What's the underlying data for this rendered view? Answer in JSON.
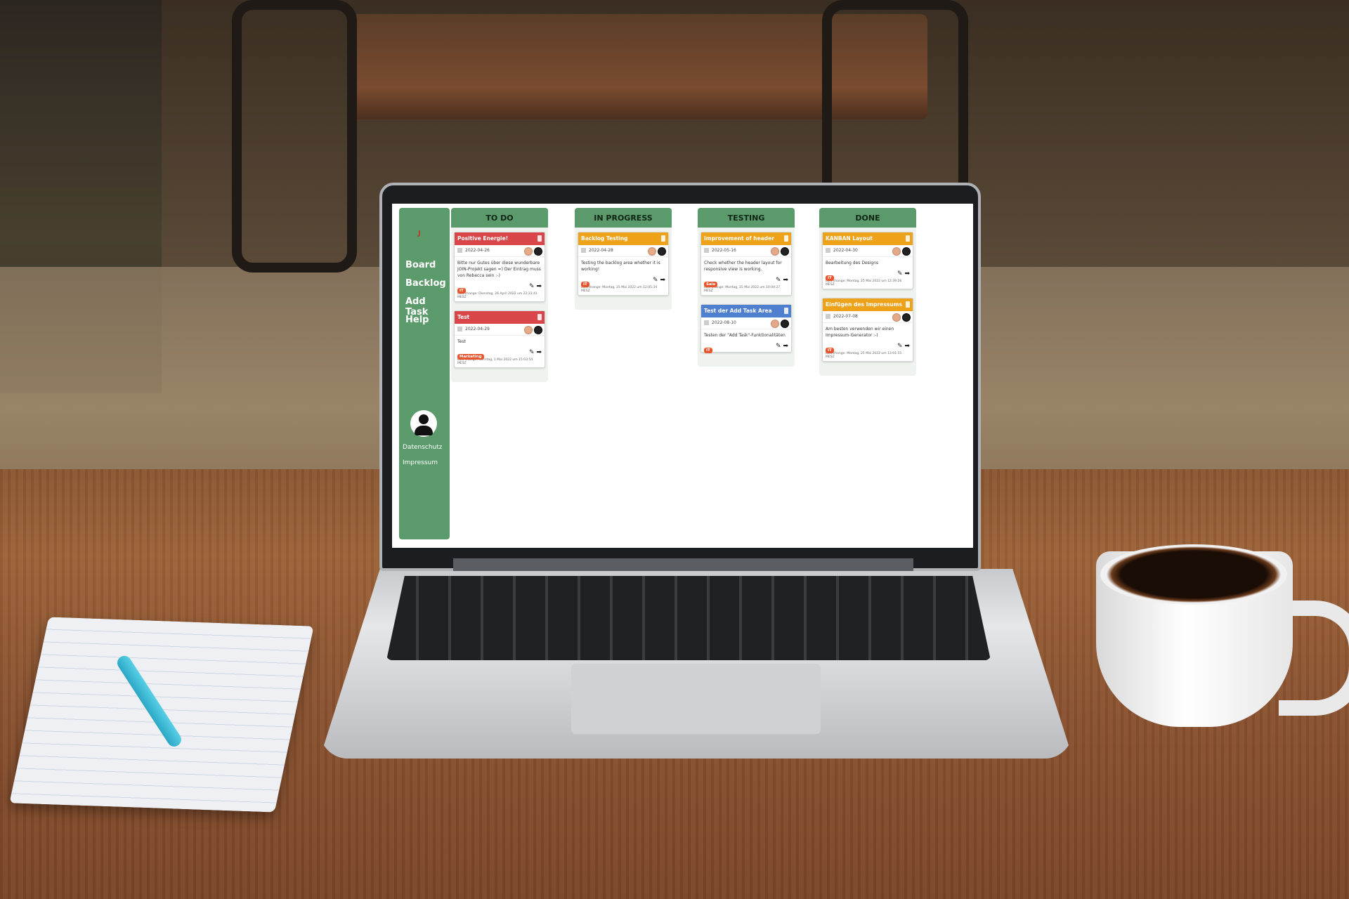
{
  "scene": {
    "colors": {
      "table": "#8b5632",
      "sidebar": "#5b9a6b",
      "todo_red": "#d9464a",
      "progress_orange": "#eda21a",
      "testing_blue": "#4f7fcf",
      "tag_orange": "#e8542c"
    }
  },
  "app": {
    "logo": "J",
    "nav": [
      "Board",
      "Backlog",
      "Add Task",
      "Help"
    ],
    "footer": [
      "Datenschutz",
      "Impressum"
    ]
  },
  "columns": [
    {
      "title": "TO DO",
      "cards": [
        {
          "title": "Positive Energie!",
          "date": "2022-04-26",
          "desc": "Bitte nur Gutes über diese wunderbare JOIN-Projekt sagen =) Der Eintrag muss von Rebecca sein :-)",
          "tag": "IT",
          "change": "Last change: Dienstag, 26 April 2022 um 22:31:41 MESZ",
          "color": "#d9464a"
        },
        {
          "title": "Test",
          "date": "2022-04-29",
          "desc": "Test",
          "tag": "Marketing",
          "change": "Last change: Sonntag, 1 Mai 2022 um 15:03:54 MESZ",
          "color": "#d9464a"
        }
      ]
    },
    {
      "title": "IN PROGRESS",
      "cards": [
        {
          "title": "Backlog Testing",
          "date": "2022-04-28",
          "desc": "Testing the backlog area whether it is working!",
          "tag": "IT",
          "change": "Last change: Montag, 25 Mai 2022 um 12:05:34 MESZ",
          "color": "#eda21a"
        }
      ]
    },
    {
      "title": "TESTING",
      "cards": [
        {
          "title": "Improvement of header layout",
          "date": "2022-05-16",
          "desc": "Check whether the header layout for responsive view is working.",
          "tag": "Sale",
          "change": "Last change: Montag, 25 Mai 2022 um 10:04:27 MESZ",
          "color": "#eda21a"
        },
        {
          "title": "Test der Add Task Area",
          "date": "2022-08-10",
          "desc": "Testen der \"Add Task\"-Funktionalitäten",
          "tag": "IT",
          "change": "",
          "color": "#4f7fcf"
        }
      ]
    },
    {
      "title": "DONE",
      "cards": [
        {
          "title": "KANBAN Layout",
          "date": "2022-04-30",
          "desc": "Bearbeitung des Designs",
          "tag": "IT",
          "change": "Last change: Montag, 25 Mai 2022 um 12:39:26 MESZ",
          "color": "#eda21a"
        },
        {
          "title": "Einfügen des Impressums",
          "date": "2022-07-08",
          "desc": "Am besten verwenden wir einen Impressum-Generator :-)",
          "tag": "IT",
          "change": "Last change: Montag, 25 Mai 2022 um 13:01:55 MESZ",
          "color": "#eda21a"
        }
      ]
    }
  ]
}
